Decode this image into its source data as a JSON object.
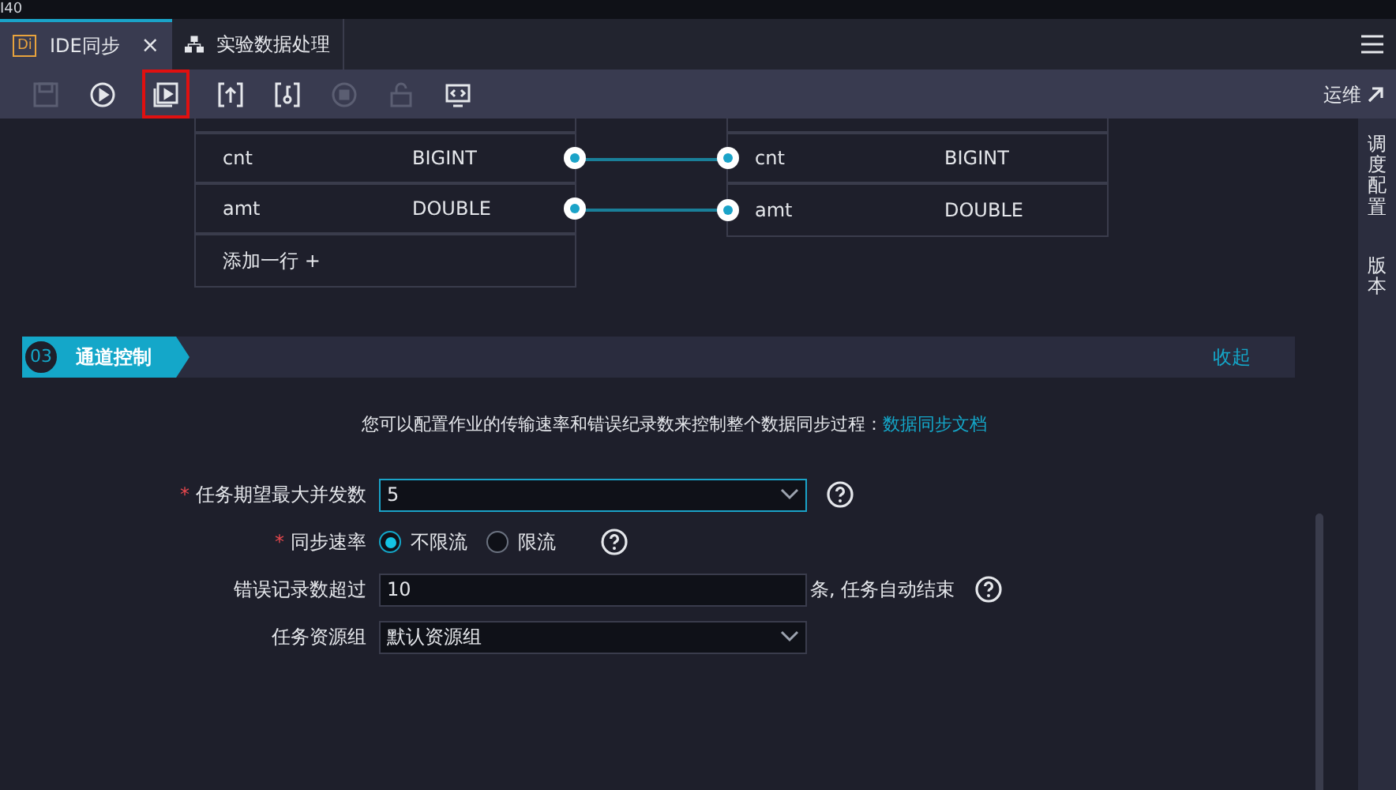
{
  "top_strip": {
    "text": "I40"
  },
  "tabs": [
    {
      "label": "IDE同步",
      "badge": "Di",
      "kind": "di",
      "selected": true,
      "close": "×"
    },
    {
      "label": "实验数据处理",
      "kind": "flow",
      "selected": false
    }
  ],
  "toolbar": {
    "buttons": [
      {
        "disabled": true,
        "highlighted": false
      },
      {
        "disabled": false,
        "highlighted": false
      },
      {
        "disabled": false,
        "highlighted": true
      },
      {
        "disabled": false,
        "highlighted": false
      },
      {
        "disabled": false,
        "highlighted": false
      },
      {
        "disabled": true,
        "highlighted": false
      },
      {
        "disabled": true,
        "highlighted": false
      },
      {
        "disabled": false,
        "highlighted": false
      }
    ],
    "ops_link": "运维"
  },
  "right_sidebar": [
    {
      "label": "调度配置"
    },
    {
      "label": "版本"
    }
  ],
  "mapping": {
    "source_rows": [
      {
        "name": "cnt",
        "type": "BIGINT"
      },
      {
        "name": "amt",
        "type": "DOUBLE"
      }
    ],
    "add_row": "添加一行 +",
    "target_rows": [
      {
        "name": "cnt",
        "type": "BIGINT"
      },
      {
        "name": "amt",
        "type": "DOUBLE"
      }
    ]
  },
  "section": {
    "number": "03",
    "title": "通道控制",
    "collapse": "收起"
  },
  "description": {
    "text": "您可以配置作业的传输速率和错误纪录数来控制整个数据同步过程：",
    "link": "数据同步文档"
  },
  "form": [
    {
      "kind": "select",
      "label": "任务期望最大并发数",
      "required_mark": "*",
      "value": "5",
      "focused": true,
      "help": true
    },
    {
      "kind": "radio",
      "label": "同步速率",
      "required_mark": "*",
      "options": [
        {
          "label": "不限流",
          "selected": true
        },
        {
          "label": "限流",
          "selected": false
        }
      ],
      "help": true
    },
    {
      "kind": "input",
      "label": "错误记录数超过",
      "value": "10",
      "suffix": "条, 任务自动结束",
      "help": true
    },
    {
      "kind": "select",
      "label": "任务资源组",
      "value": "默认资源组",
      "focused": false,
      "help": false
    }
  ]
}
